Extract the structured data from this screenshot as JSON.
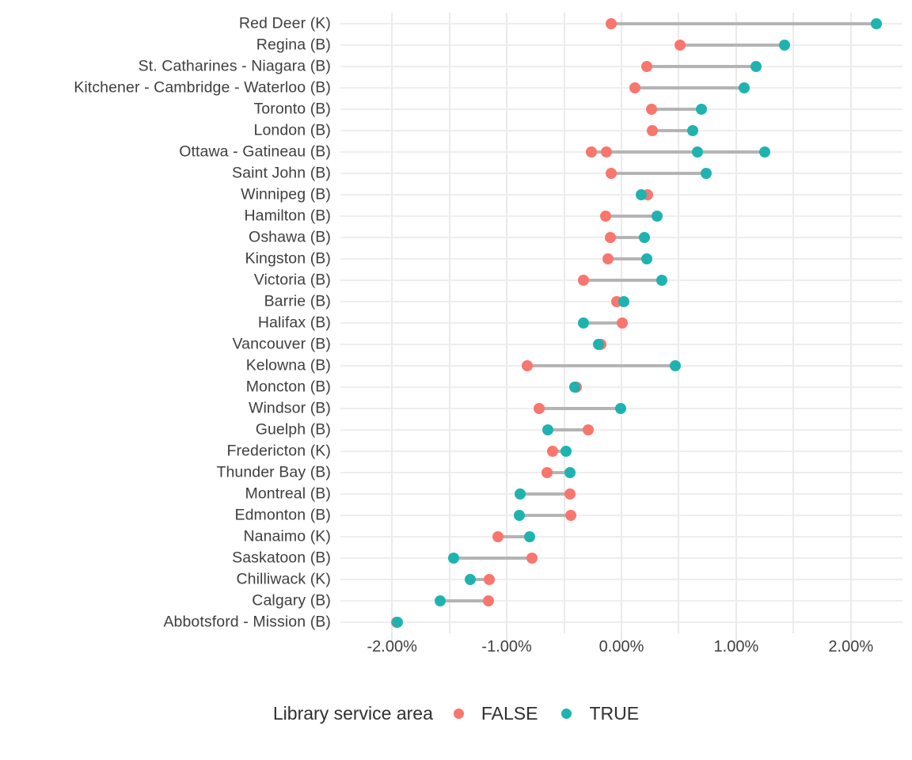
{
  "chart_data": {
    "type": "scatter",
    "subtype": "dumbbell",
    "title": "",
    "xlabel": "",
    "ylabel": "",
    "xlim": [
      -2.45,
      2.45
    ],
    "x_tick_labels": [
      "-2.00%",
      "-1.00%",
      "0.00%",
      "1.00%",
      "2.00%"
    ],
    "x_tick_values": [
      -2,
      -1,
      0,
      1,
      2
    ],
    "grid": "vertical-and-horizontal",
    "legend": {
      "title": "Library service area",
      "position": "bottom",
      "entries": [
        {
          "label": "FALSE",
          "color": "#f8766d"
        },
        {
          "label": "TRUE",
          "color": "#1fb3b0"
        }
      ]
    },
    "categories": [
      "Red Deer (K)",
      "Regina (B)",
      "St. Catharines - Niagara (B)",
      "Kitchener - Cambridge - Waterloo (B)",
      "Toronto (B)",
      "London (B)",
      "Ottawa - Gatineau (B)",
      "Saint John (B)",
      "Winnipeg (B)",
      "Hamilton (B)",
      "Oshawa (B)",
      "Kingston (B)",
      "Victoria (B)",
      "Barrie (B)",
      "Halifax (B)",
      "Vancouver (B)",
      "Kelowna (B)",
      "Moncton (B)",
      "Windsor (B)",
      "Guelph (B)",
      "Fredericton (K)",
      "Thunder Bay (B)",
      "Montreal (B)",
      "Edmonton (B)",
      "Nanaimo (K)",
      "Saskatoon (B)",
      "Chilliwack (K)",
      "Calgary (B)",
      "Abbotsford - Mission (B)"
    ],
    "rows": [
      {
        "category": "Red Deer (K)",
        "false": [
          -0.09
        ],
        "true": [
          2.22
        ]
      },
      {
        "category": "Regina (B)",
        "false": [
          0.51
        ],
        "true": [
          1.42
        ]
      },
      {
        "category": "St. Catharines - Niagara (B)",
        "false": [
          0.22
        ],
        "true": [
          1.17
        ]
      },
      {
        "category": "Kitchener - Cambridge - Waterloo (B)",
        "false": [
          0.12
        ],
        "true": [
          1.07
        ]
      },
      {
        "category": "Toronto (B)",
        "false": [
          0.26
        ],
        "true": [
          0.7
        ]
      },
      {
        "category": "London (B)",
        "false": [
          0.27
        ],
        "true": [
          0.62
        ]
      },
      {
        "category": "Ottawa - Gatineau (B)",
        "false": [
          -0.26,
          -0.13
        ],
        "true": [
          0.66,
          1.25
        ]
      },
      {
        "category": "Saint John (B)",
        "false": [
          -0.09
        ],
        "true": [
          0.74
        ]
      },
      {
        "category": "Winnipeg (B)",
        "false": [
          0.23
        ],
        "true": [
          0.17
        ]
      },
      {
        "category": "Hamilton (B)",
        "false": [
          -0.14
        ],
        "true": [
          0.31
        ]
      },
      {
        "category": "Oshawa (B)",
        "false": [
          -0.1
        ],
        "true": [
          0.2
        ]
      },
      {
        "category": "Kingston (B)",
        "false": [
          -0.12
        ],
        "true": [
          0.22
        ]
      },
      {
        "category": "Victoria (B)",
        "false": [
          -0.33
        ],
        "true": [
          0.35
        ]
      },
      {
        "category": "Barrie (B)",
        "false": [
          -0.04
        ],
        "true": [
          0.02
        ]
      },
      {
        "category": "Halifax (B)",
        "false": [
          0.01
        ],
        "true": [
          -0.33
        ]
      },
      {
        "category": "Vancouver (B)",
        "false": [
          -0.18
        ],
        "true": [
          -0.2
        ]
      },
      {
        "category": "Kelowna (B)",
        "false": [
          -0.82
        ],
        "true": [
          0.47
        ]
      },
      {
        "category": "Moncton (B)",
        "false": [
          -0.39
        ],
        "true": [
          -0.41
        ]
      },
      {
        "category": "Windsor (B)",
        "false": [
          -0.72
        ],
        "true": [
          -0.01
        ]
      },
      {
        "category": "Guelph (B)",
        "false": [
          -0.29
        ],
        "true": [
          -0.64
        ]
      },
      {
        "category": "Fredericton (K)",
        "false": [
          -0.6
        ],
        "true": [
          -0.48
        ]
      },
      {
        "category": "Thunder Bay (B)",
        "false": [
          -0.65
        ],
        "true": [
          -0.45
        ]
      },
      {
        "category": "Montreal (B)",
        "false": [
          -0.45
        ],
        "true": [
          -0.88
        ]
      },
      {
        "category": "Edmonton (B)",
        "false": [
          -0.44
        ],
        "true": [
          -0.89
        ]
      },
      {
        "category": "Nanaimo (K)",
        "false": [
          -1.08
        ],
        "true": [
          -0.8
        ]
      },
      {
        "category": "Saskatoon (B)",
        "false": [
          -0.78
        ],
        "true": [
          -1.46
        ]
      },
      {
        "category": "Chilliwack (K)",
        "false": [
          -1.15
        ],
        "true": [
          -1.32
        ]
      },
      {
        "category": "Calgary (B)",
        "false": [
          -1.16
        ],
        "true": [
          -1.58
        ]
      },
      {
        "category": "Abbotsford - Mission (B)",
        "false": [
          -1.96
        ],
        "true": [
          -1.95
        ]
      }
    ]
  },
  "colors": {
    "false": "#f8766d",
    "true": "#1fb3b0",
    "connector": "#b4b4b4",
    "grid": "#ececec",
    "text": "#3f3f3f"
  }
}
